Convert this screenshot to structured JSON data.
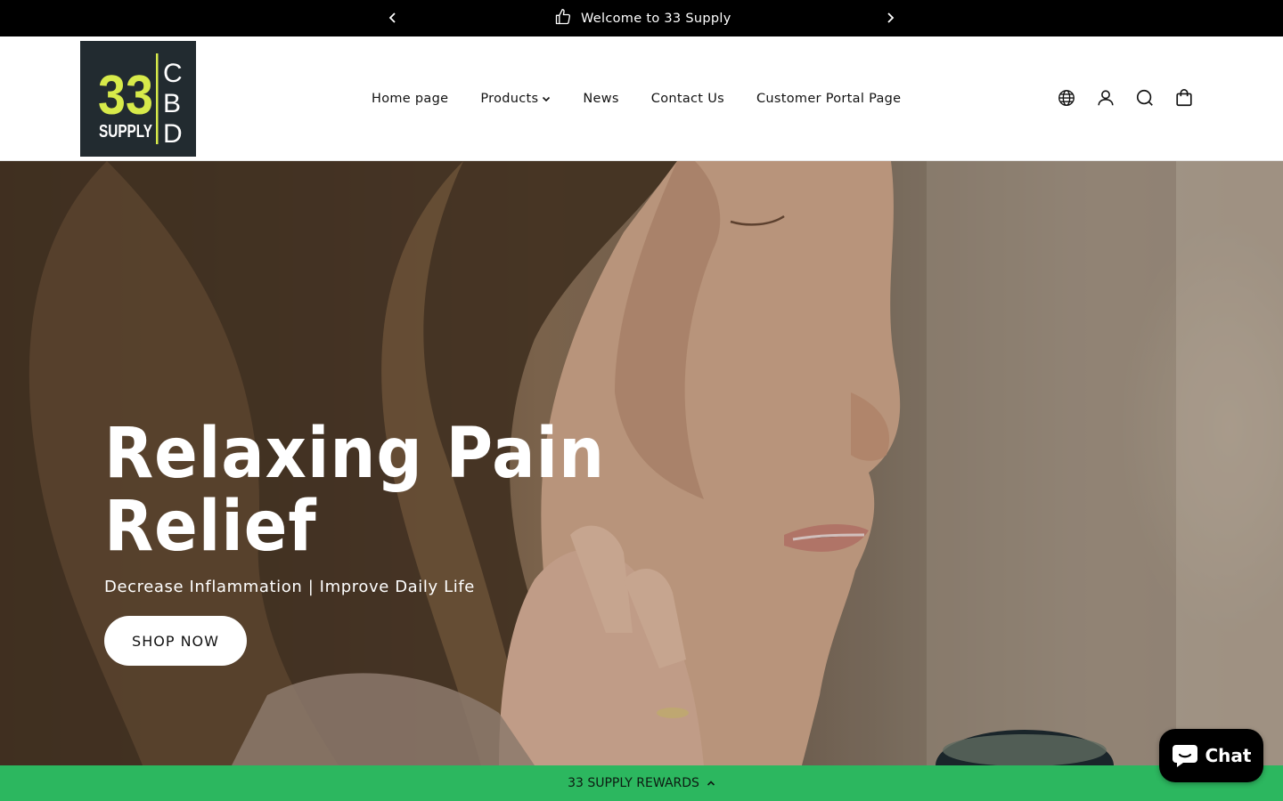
{
  "announcement": {
    "prev_icon": "chevron-left-icon",
    "next_icon": "chevron-right-icon",
    "icon": "thumbs-up-icon",
    "message": "Welcome to 33 Supply"
  },
  "header": {
    "logo": {
      "numeral": "33",
      "word": "SUPPLY",
      "side_letters": [
        "C",
        "B",
        "D"
      ],
      "bg_color": "#222b30",
      "accent_color": "#d7ea4a"
    },
    "nav": [
      {
        "label": "Home page"
      },
      {
        "label": "Products",
        "has_dropdown": true
      },
      {
        "label": "News"
      },
      {
        "label": "Contact Us"
      },
      {
        "label": "Customer Portal Page"
      }
    ],
    "icons": [
      "globe-icon",
      "account-icon",
      "search-icon",
      "cart-icon"
    ]
  },
  "hero": {
    "title_line1": "Relaxing Pain",
    "title_line2": "Relief",
    "subtitle": "Decrease Inflammation | Improve Daily Life",
    "button_label": "SHOP NOW"
  },
  "rewards": {
    "label": "33 SUPPLY REWARDS",
    "bg_color": "#2cb75f"
  },
  "chat": {
    "label": "Chat",
    "bg_color": "#000000"
  }
}
